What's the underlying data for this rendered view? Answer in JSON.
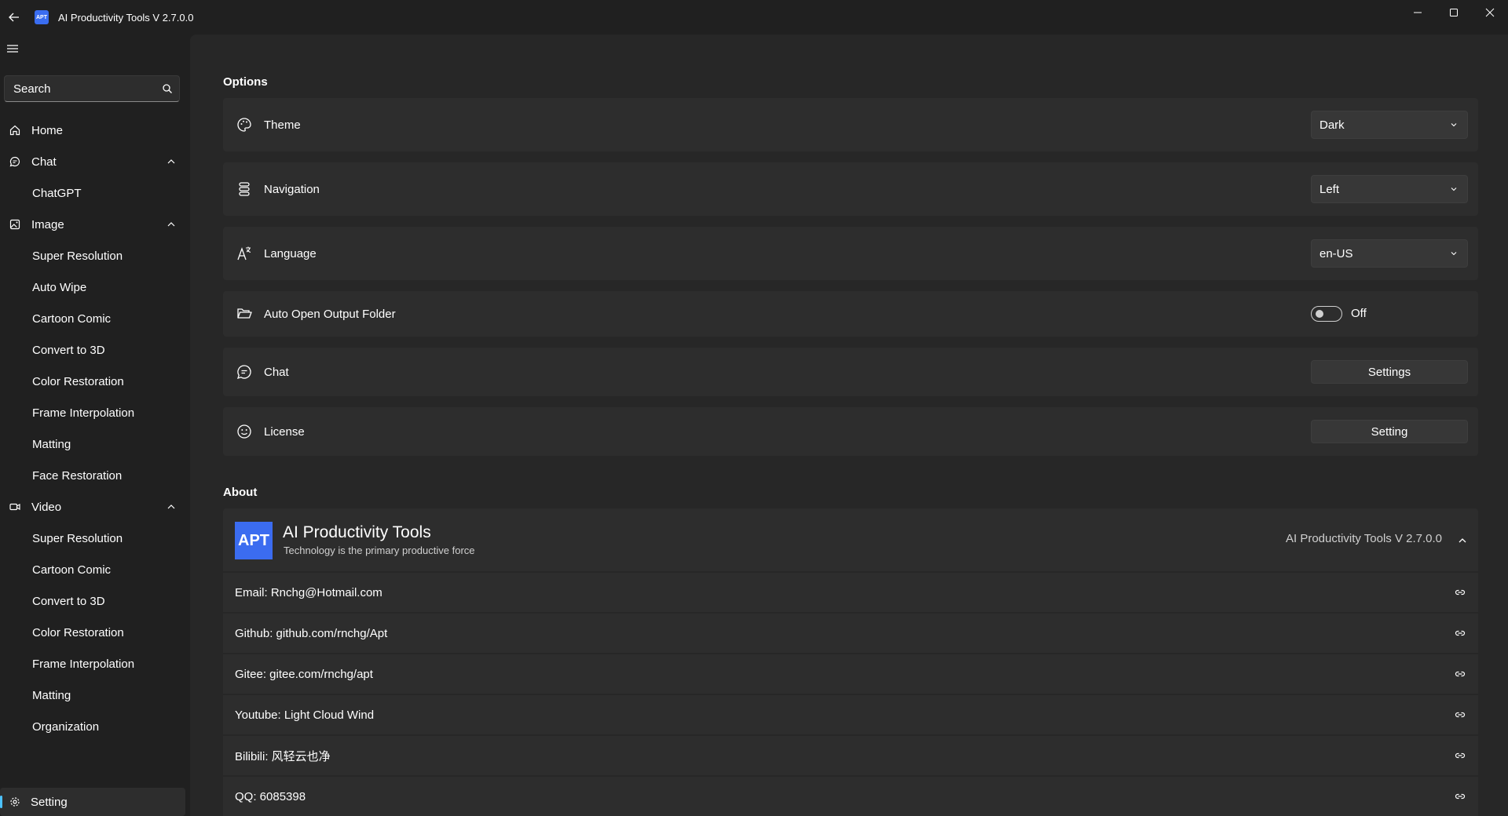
{
  "window": {
    "title": "AI Productivity Tools V 2.7.0.0",
    "app_icon_text": "APT"
  },
  "sidebar": {
    "search_placeholder": "Search",
    "items": [
      {
        "label": "Home",
        "icon": "home-icon"
      },
      {
        "label": "Chat",
        "icon": "chat-icon",
        "expanded": true,
        "children": [
          "ChatGPT"
        ]
      },
      {
        "label": "Image",
        "icon": "image-icon",
        "expanded": true,
        "children": [
          "Super Resolution",
          "Auto Wipe",
          "Cartoon Comic",
          "Convert to 3D",
          "Color Restoration",
          "Frame Interpolation",
          "Matting",
          "Face Restoration"
        ]
      },
      {
        "label": "Video",
        "icon": "video-icon",
        "expanded": true,
        "children": [
          "Super Resolution",
          "Cartoon Comic",
          "Convert to 3D",
          "Color Restoration",
          "Frame Interpolation",
          "Matting",
          "Organization"
        ]
      }
    ],
    "footer": {
      "label": "Setting",
      "icon": "gear-icon",
      "selected": true
    }
  },
  "options": {
    "title": "Options",
    "theme": {
      "label": "Theme",
      "value": "Dark"
    },
    "navigation": {
      "label": "Navigation",
      "value": "Left"
    },
    "language": {
      "label": "Language",
      "value": "en-US"
    },
    "auto_open": {
      "label": "Auto Open Output Folder",
      "state": "Off",
      "on": false
    },
    "chat": {
      "label": "Chat",
      "button": "Settings"
    },
    "license": {
      "label": "License",
      "button": "Setting"
    }
  },
  "about": {
    "title": "About",
    "logo_text": "APT",
    "name": "AI Productivity Tools",
    "subtitle": "Technology is the primary productive force",
    "version": "AI Productivity Tools V 2.7.0.0",
    "rows": [
      "Email: Rnchg@Hotmail.com",
      "Github: github.com/rnchg/Apt",
      "Gitee: gitee.com/rnchg/apt",
      "Youtube: Light Cloud Wind",
      "Bilibili: 风轻云也净",
      "QQ: 6085398"
    ]
  },
  "colors": {
    "accent": "#4cc2ff",
    "logo_bg": "#3b6cf0",
    "background": "#202020",
    "card": "#2d2d2d"
  }
}
